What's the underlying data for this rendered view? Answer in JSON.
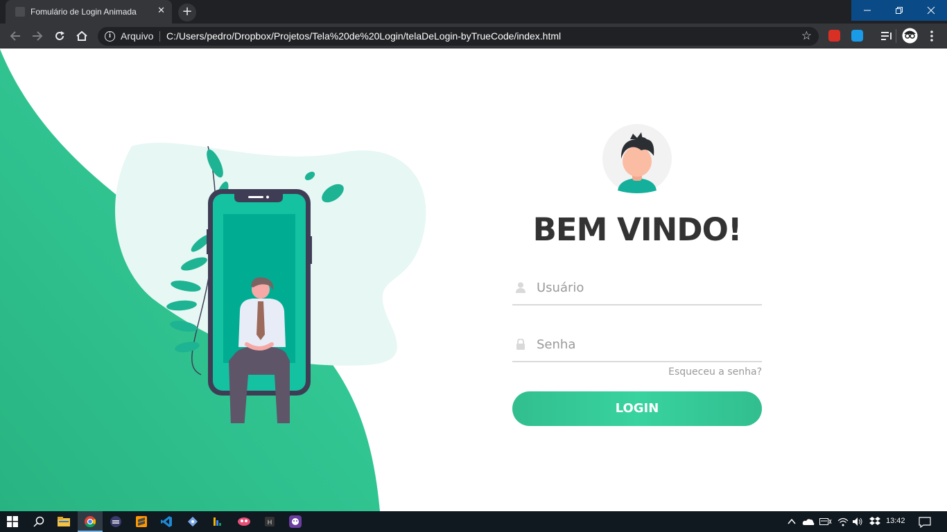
{
  "browser": {
    "tab_title": "Fomulário de Login Animada",
    "new_tab_symbol": "+",
    "close_symbol": "✕",
    "site_info_label": "Arquivo",
    "url": "C:/Users/pedro/Dropbox/Projetos/Tela%20de%20Login/telaDeLogin-byTrueCode/index.html"
  },
  "login": {
    "title": "BEM VINDO!",
    "username_placeholder": "Usuário",
    "password_placeholder": "Senha",
    "forgot_link": "Esqueceu a senha?",
    "button_label": "LOGIN"
  },
  "colors": {
    "accent": "#32be8f",
    "accent_light": "#38d39f",
    "phone_frame": "#3f3d56",
    "text_dark": "#333333",
    "text_muted": "#999999"
  },
  "taskbar": {
    "time": "13:42",
    "apps": [
      "windows-start-icon",
      "search-icon",
      "file-explorer-icon",
      "chrome-icon",
      "app-icon",
      "sublime-icon",
      "vscode-icon",
      "git-icon",
      "app-icon",
      "app-icon",
      "app-icon",
      "app-icon"
    ]
  }
}
